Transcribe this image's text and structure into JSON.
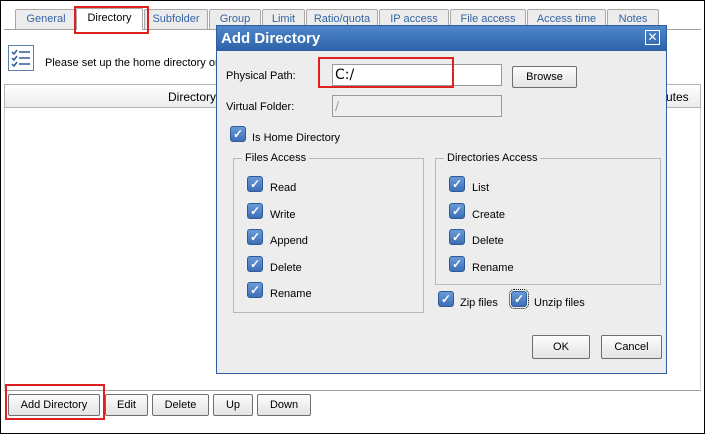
{
  "tabs": [
    "General",
    "Directory",
    "Subfolder",
    "Group",
    "Limit",
    "Ratio/quota",
    "IP access",
    "File access",
    "Access time",
    "Notes"
  ],
  "info_text": "Please set up the home directory or",
  "table": {
    "col_directory": "Directory",
    "col_attributes": "utes"
  },
  "bottom_buttons": {
    "add": "Add Directory",
    "edit": "Edit",
    "delete": "Delete",
    "up": "Up",
    "down": "Down"
  },
  "dialog": {
    "title": "Add Directory",
    "close_glyph": "✕",
    "physical_path_label": "Physical Path:",
    "physical_path_value": "C:/",
    "browse_label": "Browse",
    "virtual_folder_label": "Virtual Folder:",
    "virtual_folder_value": "/",
    "home_dir_label": "Is Home Directory",
    "files_access": {
      "title": "Files Access",
      "items": [
        "Read",
        "Write",
        "Append",
        "Delete",
        "Rename"
      ]
    },
    "dirs_access": {
      "title": "Directories Access",
      "items": [
        "List",
        "Create",
        "Delete",
        "Rename"
      ]
    },
    "zip_label": "Zip files",
    "unzip_label": "Unzip files",
    "ok_label": "OK",
    "cancel_label": "Cancel"
  },
  "check_glyph": "✓",
  "colors": {
    "accent": "#3c6fb6",
    "highlight": "#e02020",
    "title_bar": "#2d62a8"
  }
}
